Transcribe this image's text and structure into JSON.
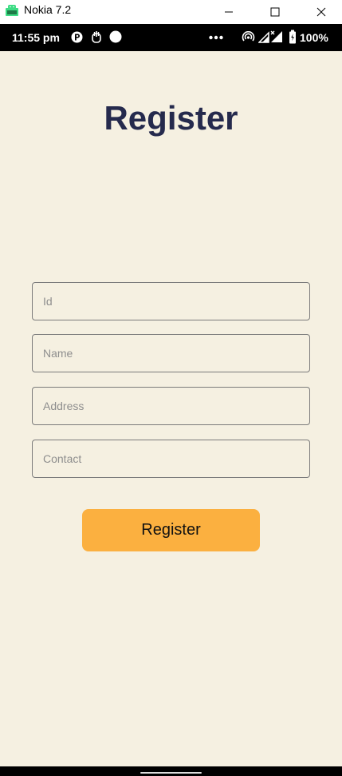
{
  "window": {
    "title": "Nokia 7.2",
    "icons": {
      "app": "android-robot-icon",
      "minimize": "minimize-icon",
      "maximize": "maximize-icon",
      "close": "close-icon"
    }
  },
  "status_bar": {
    "time": "11:55 pm",
    "battery_percent": "100%",
    "icons": [
      "p-app-icon",
      "hand-icon",
      "circle-icon",
      "more-dots-icon",
      "hotspot-icon",
      "signal-icon",
      "signal-x-icon",
      "battery-icon"
    ]
  },
  "register_form": {
    "title": "Register",
    "fields": {
      "id": {
        "placeholder": "Id",
        "value": ""
      },
      "name": {
        "placeholder": "Name",
        "value": ""
      },
      "address": {
        "placeholder": "Address",
        "value": ""
      },
      "contact": {
        "placeholder": "Contact",
        "value": ""
      }
    },
    "submit_label": "Register"
  },
  "colors": {
    "background": "#f5f0e1",
    "title": "#252a4d",
    "button": "#fbb040",
    "field_border": "#7b7b7b"
  }
}
